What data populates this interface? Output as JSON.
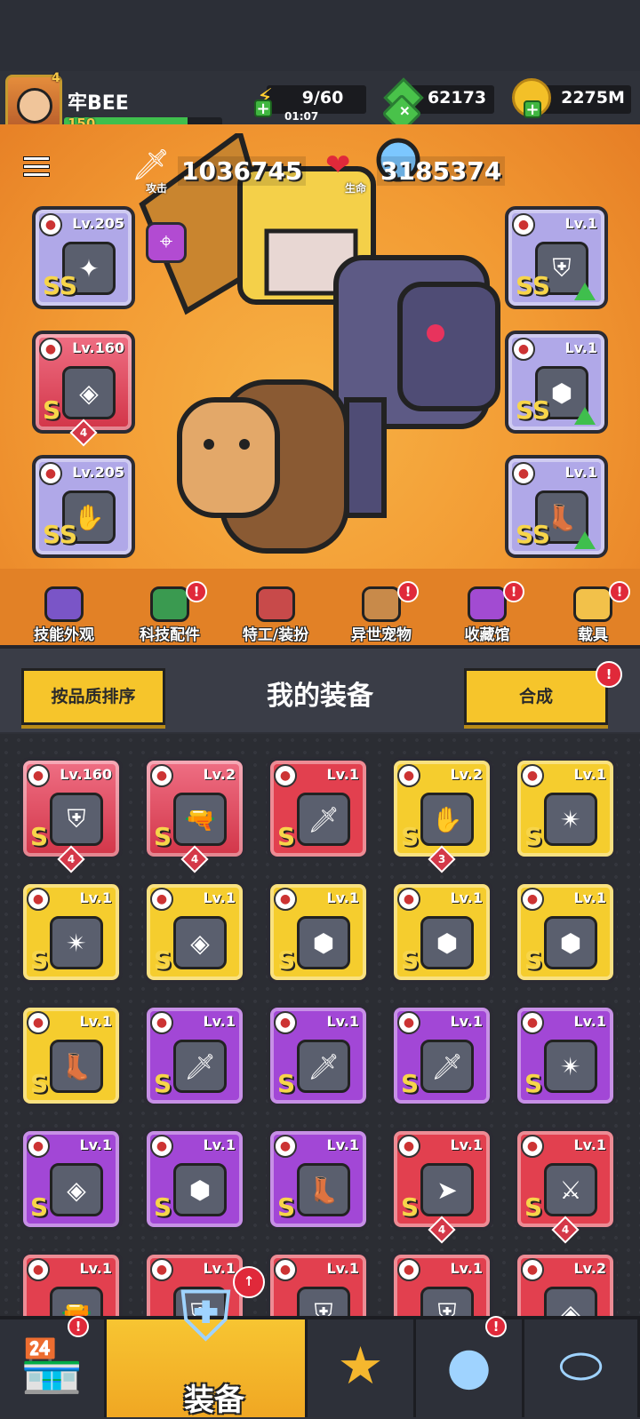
{
  "player": {
    "name": "牢BEE",
    "avatar_level": "4",
    "level": "150",
    "xp_fraction": 0.78
  },
  "resources": {
    "energy": {
      "value": "9/60",
      "timer": "01:07"
    },
    "gems": {
      "value": "62173"
    },
    "coins": {
      "value": "2275M"
    }
  },
  "stats": {
    "attack": {
      "label": "攻击",
      "value": "1036745"
    },
    "health": {
      "label": "生命",
      "value": "3185374"
    }
  },
  "equipped_left": [
    {
      "level": "Lv.205",
      "tier": "SS",
      "quality": "blueish",
      "icon": "staff-icon"
    },
    {
      "level": "Lv.160",
      "tier": "S",
      "quality": "redglow",
      "icon": "necklace-icon",
      "count": "4"
    },
    {
      "level": "Lv.205",
      "tier": "SS",
      "quality": "blueish",
      "icon": "gauntlet-icon"
    }
  ],
  "equipped_right": [
    {
      "level": "Lv.1",
      "tier": "SS",
      "quality": "blueish",
      "icon": "armor-icon",
      "upgradable": true
    },
    {
      "level": "Lv.1",
      "tier": "SS",
      "quality": "blueish",
      "icon": "belt-icon",
      "upgradable": true
    },
    {
      "level": "Lv.1",
      "tier": "SS",
      "quality": "blueish",
      "icon": "boots-icon",
      "upgradable": true
    }
  ],
  "nav": [
    {
      "label": "技能外观",
      "icon": "skin-hat-icon",
      "color": "#7a55c7",
      "notif": false
    },
    {
      "label": "科技配件",
      "icon": "tech-part-icon",
      "color": "#3a9a50",
      "notif": true
    },
    {
      "label": "特工/装扮",
      "icon": "agent-icon",
      "color": "#c84a4a",
      "notif": false
    },
    {
      "label": "异世宠物",
      "icon": "pet-icon",
      "color": "#c88a4a",
      "notif": true
    },
    {
      "label": "收藏馆",
      "icon": "collection-icon",
      "color": "#a24bd2",
      "notif": true
    },
    {
      "label": "载具",
      "icon": "vehicle-icon",
      "color": "#f2c14a",
      "notif": true
    }
  ],
  "equip_panel": {
    "sort_label": "按品质排序",
    "title": "我的装备",
    "merge_label": "合成",
    "notif": "!"
  },
  "inventory": [
    {
      "level": "Lv.160",
      "quality": "redglow",
      "icon": "armor-icon",
      "count": "4"
    },
    {
      "level": "Lv.2",
      "quality": "redglow",
      "icon": "water-gun-icon",
      "count": "4"
    },
    {
      "level": "Lv.1",
      "quality": "red",
      "icon": "sword-icon"
    },
    {
      "level": "Lv.2",
      "quality": "yellow",
      "icon": "gauntlet-icon",
      "count": "3"
    },
    {
      "level": "Lv.1",
      "quality": "yellow",
      "icon": "spiked-blade-icon"
    },
    {
      "level": "Lv.1",
      "quality": "yellow",
      "icon": "spiked-blade-icon"
    },
    {
      "level": "Lv.1",
      "quality": "yellow",
      "icon": "necklace-icon"
    },
    {
      "level": "Lv.1",
      "quality": "yellow",
      "icon": "belt-icon"
    },
    {
      "level": "Lv.1",
      "quality": "yellow",
      "icon": "belt-icon"
    },
    {
      "level": "Lv.1",
      "quality": "yellow",
      "icon": "belt-icon"
    },
    {
      "level": "Lv.1",
      "quality": "yellow",
      "icon": "boots-icon"
    },
    {
      "level": "Lv.1",
      "quality": "purple",
      "icon": "sword-icon"
    },
    {
      "level": "Lv.1",
      "quality": "purple",
      "icon": "sword-icon"
    },
    {
      "level": "Lv.1",
      "quality": "purple",
      "icon": "sword-icon"
    },
    {
      "level": "Lv.1",
      "quality": "purple",
      "icon": "spiked-blade-icon"
    },
    {
      "level": "Lv.1",
      "quality": "purple",
      "icon": "necklace-icon"
    },
    {
      "level": "Lv.1",
      "quality": "purple",
      "icon": "belt-icon"
    },
    {
      "level": "Lv.1",
      "quality": "purple",
      "icon": "boots-icon"
    },
    {
      "level": "Lv.1",
      "quality": "red",
      "icon": "kunai-icon",
      "count": "4"
    },
    {
      "level": "Lv.1",
      "quality": "red",
      "icon": "scimitar-icon",
      "count": "4"
    },
    {
      "level": "Lv.1",
      "quality": "red",
      "icon": "revolver-icon"
    },
    {
      "level": "Lv.1",
      "quality": "red",
      "icon": "armor-icon"
    },
    {
      "level": "Lv.1",
      "quality": "red",
      "icon": "armor-icon"
    },
    {
      "level": "Lv.1",
      "quality": "red",
      "icon": "armor-icon"
    },
    {
      "level": "Lv.2",
      "quality": "red",
      "icon": "necklace-icon"
    }
  ],
  "bottom_nav": [
    {
      "icon": "shop-icon",
      "notif": true
    },
    {
      "icon": "equipment-icon",
      "label": "装备",
      "active": true,
      "notif_up": true
    },
    {
      "icon": "battle-star-icon",
      "notif": false
    },
    {
      "icon": "planet-icon",
      "notif": true
    },
    {
      "icon": "gene-capsule-icon",
      "notif": false
    }
  ],
  "tier_label": "S"
}
